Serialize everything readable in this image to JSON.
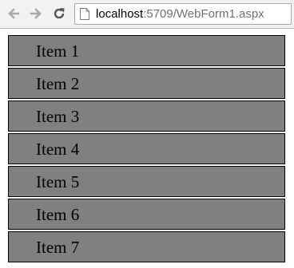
{
  "browser": {
    "url_host": "localhost",
    "url_path": ":5709/WebForm1.aspx",
    "icons": {
      "back": "back-arrow-icon",
      "forward": "forward-arrow-icon",
      "reload": "reload-icon",
      "page": "page-icon"
    }
  },
  "list": {
    "items": [
      {
        "label": "Item 1"
      },
      {
        "label": "Item 2"
      },
      {
        "label": "Item 3"
      },
      {
        "label": "Item 4"
      },
      {
        "label": "Item 5"
      },
      {
        "label": "Item 6"
      },
      {
        "label": "Item 7"
      }
    ],
    "colors": {
      "item_bg": "#808080",
      "item_border": "#000000",
      "text": "#000000"
    }
  }
}
